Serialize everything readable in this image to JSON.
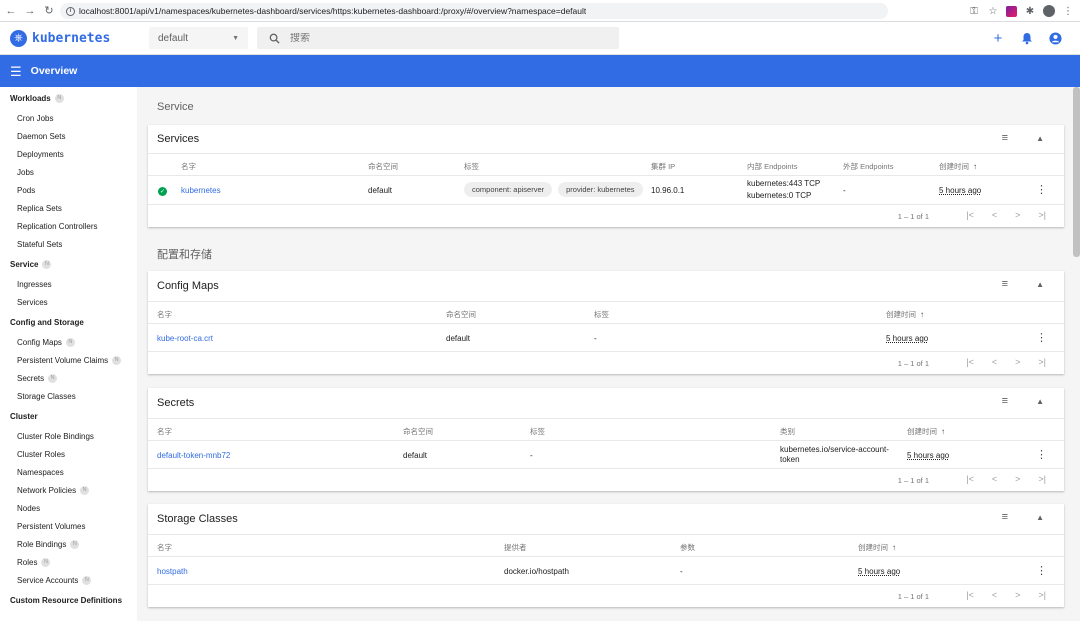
{
  "browser": {
    "url": "localhost:8001/api/v1/namespaces/kubernetes-dashboard/services/https:kubernetes-dashboard:/proxy/#/overview?namespace=default"
  },
  "app": {
    "logo_text": "kubernetes",
    "namespace": "default",
    "search_placeholder": "搜索",
    "brand_color": "#326ce5"
  },
  "header": {
    "title": "Overview"
  },
  "sidebar": {
    "sections": [
      {
        "label": "Workloads",
        "badge": "N",
        "items": [
          {
            "label": "Cron Jobs"
          },
          {
            "label": "Daemon Sets"
          },
          {
            "label": "Deployments"
          },
          {
            "label": "Jobs"
          },
          {
            "label": "Pods"
          },
          {
            "label": "Replica Sets"
          },
          {
            "label": "Replication Controllers"
          },
          {
            "label": "Stateful Sets"
          }
        ]
      },
      {
        "label": "Service",
        "badge": "N",
        "items": [
          {
            "label": "Ingresses"
          },
          {
            "label": "Services"
          }
        ]
      },
      {
        "label": "Config and Storage",
        "items": [
          {
            "label": "Config Maps",
            "badge": "N"
          },
          {
            "label": "Persistent Volume Claims",
            "badge": "N"
          },
          {
            "label": "Secrets",
            "badge": "N"
          },
          {
            "label": "Storage Classes"
          }
        ]
      },
      {
        "label": "Cluster",
        "items": [
          {
            "label": "Cluster Role Bindings"
          },
          {
            "label": "Cluster Roles"
          },
          {
            "label": "Namespaces"
          },
          {
            "label": "Network Policies",
            "badge": "N"
          },
          {
            "label": "Nodes"
          },
          {
            "label": "Persistent Volumes"
          },
          {
            "label": "Role Bindings",
            "badge": "N"
          },
          {
            "label": "Roles",
            "badge": "N"
          },
          {
            "label": "Service Accounts",
            "badge": "N"
          }
        ]
      },
      {
        "label": "Custom Resource Definitions",
        "items": []
      }
    ]
  },
  "main": {
    "section_service": "Service",
    "section_config": "配置和存储",
    "services": {
      "title": "Services",
      "headers": [
        "名字",
        "命名空间",
        "标签",
        "集群 IP",
        "内部 Endpoints",
        "外部 Endpoints",
        "创建时间"
      ],
      "row": {
        "name": "kubernetes",
        "namespace": "default",
        "label1": "component: apiserver",
        "label2": "provider: kubernetes",
        "cluster_ip": "10.96.0.1",
        "endpoint1": "kubernetes:443 TCP",
        "endpoint2": "kubernetes:0 TCP",
        "external": "-",
        "created": "5 hours ago"
      },
      "pager": "1 – 1 of 1"
    },
    "configmaps": {
      "title": "Config Maps",
      "headers": [
        "名字",
        "命名空间",
        "标签",
        "创建时间"
      ],
      "row": {
        "name": "kube-root-ca.crt",
        "namespace": "default",
        "labels": "-",
        "created": "5 hours ago"
      },
      "pager": "1 – 1 of 1"
    },
    "secrets": {
      "title": "Secrets",
      "headers": [
        "名字",
        "命名空间",
        "标签",
        "类别",
        "创建时间"
      ],
      "row": {
        "name": "default-token-mnb72",
        "namespace": "default",
        "labels": "-",
        "type1": "kubernetes.io/service-account-",
        "type2": "token",
        "created": "5 hours ago"
      },
      "pager": "1 – 1 of 1"
    },
    "storageclasses": {
      "title": "Storage Classes",
      "headers": [
        "名字",
        "提供者",
        "参数",
        "创建时间"
      ],
      "row": {
        "name": "hostpath",
        "provisioner": "docker.io/hostpath",
        "params": "-",
        "created": "5 hours ago"
      },
      "pager": "1 – 1 of 1"
    }
  }
}
